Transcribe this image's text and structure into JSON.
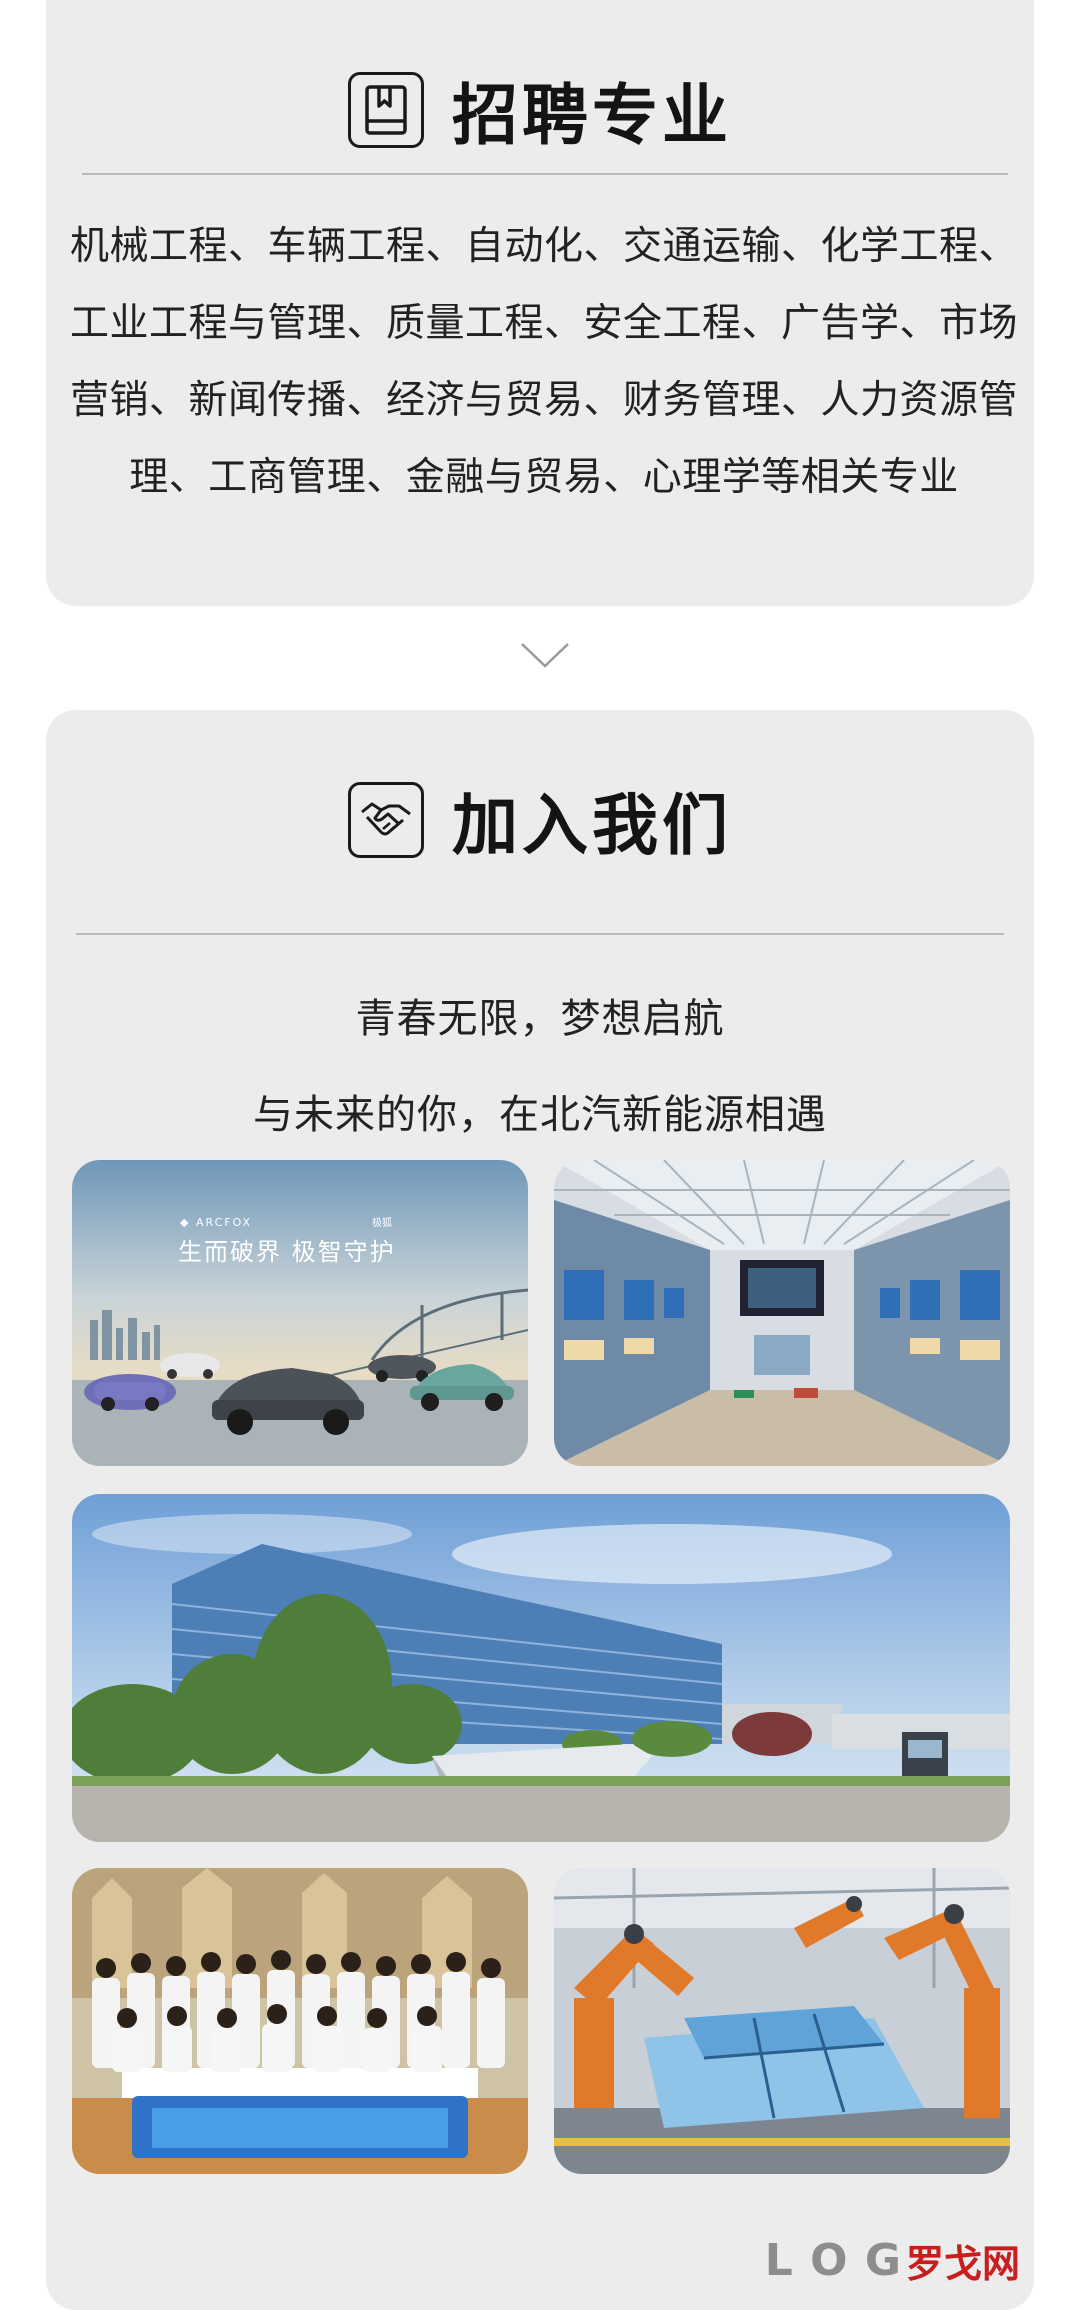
{
  "majors": {
    "title": "招聘专业",
    "icon": "book-icon",
    "text": "机械工程、车辆工程、自动化、交通运输、化学工程、工业工程与管理、质量工程、安全工程、广告学、市场营销、新闻传播、经济与贸易、财务管理、人力资源管理、工商管理、金融与贸易、心理学等相关专业"
  },
  "separator_icon": "chevron-down-icon",
  "join": {
    "title": "加入我们",
    "icon": "handshake-icon",
    "slogan_line1": "青春无限，梦想启航",
    "slogan_line2": "与未来的你，在北汽新能源相遇"
  },
  "photos": {
    "ad": {
      "brand": "ARCFOX",
      "brand_sub": "极狐",
      "tagline": "生而破界  极智守护"
    }
  },
  "watermark": {
    "logo_text": "L O G",
    "brand_cn": "罗戈网"
  },
  "colors": {
    "card_bg": "#ececec",
    "text": "#1a1a1a",
    "divider": "#b9b9b9",
    "watermark_red": "#c81e1e"
  }
}
